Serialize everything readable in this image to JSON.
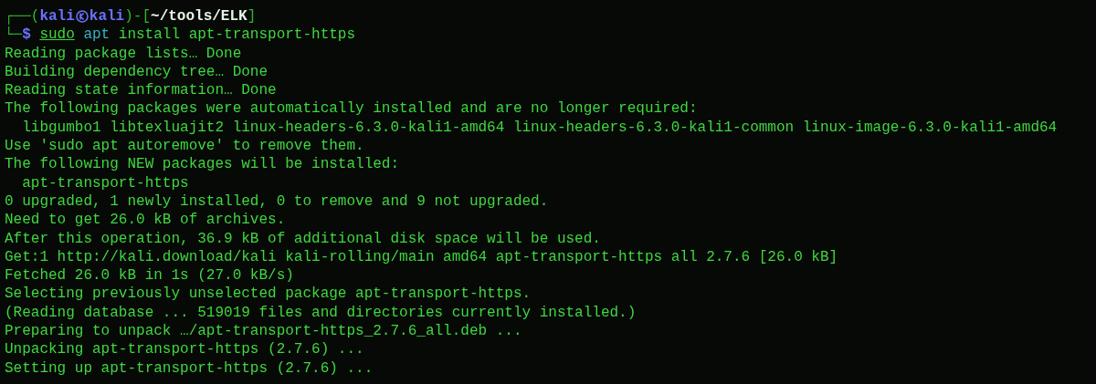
{
  "prompt": {
    "top_left": "┌──(",
    "user": "kali",
    "host": "kali",
    "mid": ")-[",
    "path": "~/tools/ELK",
    "end": "]",
    "bottom_left": "└─",
    "symbol": "$",
    "command": [
      {
        "text": "sudo",
        "kind": "sudo"
      },
      {
        "text": "apt",
        "kind": "program"
      },
      {
        "text": "install apt-transport-https",
        "kind": "arg"
      }
    ]
  },
  "output": [
    "Reading package lists… Done",
    "Building dependency tree… Done",
    "Reading state information… Done",
    "The following packages were automatically installed and are no longer required:",
    "  libgumbo1 libtexluajit2 linux-headers-6.3.0-kali1-amd64 linux-headers-6.3.0-kali1-common linux-image-6.3.0-kali1-amd64",
    "Use 'sudo apt autoremove' to remove them.",
    "The following NEW packages will be installed:",
    "  apt-transport-https",
    "0 upgraded, 1 newly installed, 0 to remove and 9 not upgraded.",
    "Need to get 26.0 kB of archives.",
    "After this operation, 36.9 kB of additional disk space will be used.",
    "Get:1 http://kali.download/kali kali-rolling/main amd64 apt-transport-https all 2.7.6 [26.0 kB]",
    "Fetched 26.0 kB in 1s (27.0 kB/s)",
    "Selecting previously unselected package apt-transport-https.",
    "(Reading database ... 519019 files and directories currently installed.)",
    "Preparing to unpack …/apt-transport-https_2.7.6_all.deb ...",
    "Unpacking apt-transport-https (2.7.6) ...",
    "Setting up apt-transport-https (2.7.6) ..."
  ]
}
